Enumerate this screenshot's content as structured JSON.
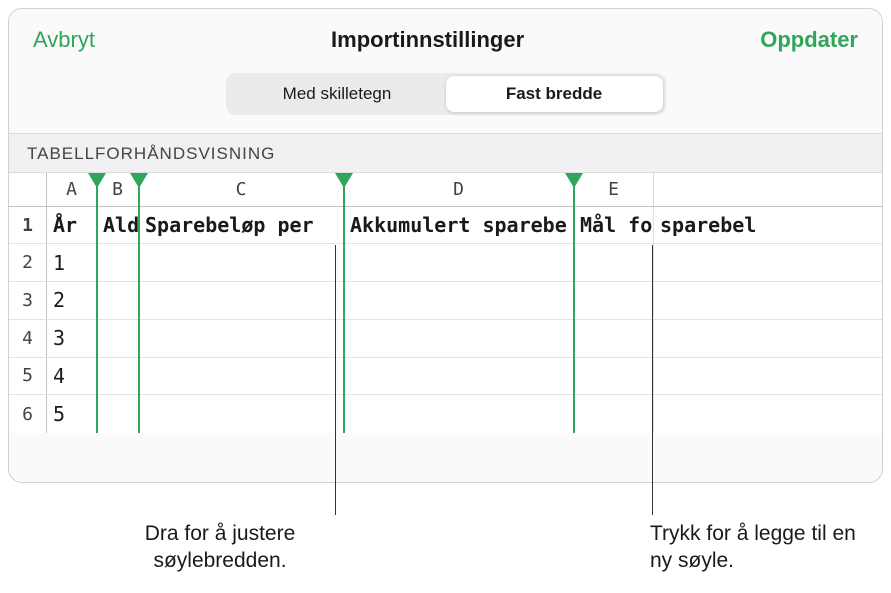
{
  "header": {
    "cancel": "Avbryt",
    "title": "Importinnstillinger",
    "update": "Oppdater"
  },
  "segmented": {
    "delimited": "Med skilletegn",
    "fixed_width": "Fast bredde"
  },
  "section_label": "TABELLFORHÅNDSVISNING",
  "columns": {
    "letters": [
      "A",
      "B",
      "C",
      "D",
      "E"
    ],
    "widths": [
      50,
      42,
      205,
      230,
      80
    ]
  },
  "rows": [
    {
      "num": "1",
      "cells": [
        "År",
        "Ald",
        "Sparebeløp per",
        "Akkumulert sparebe",
        "Mål for"
      ],
      "trailing": "sparebel",
      "bold": true
    },
    {
      "num": "2",
      "cells": [
        "1",
        "",
        "",
        "",
        ""
      ],
      "trailing": "",
      "bold": false
    },
    {
      "num": "3",
      "cells": [
        "2",
        "",
        "",
        "",
        ""
      ],
      "trailing": "",
      "bold": false
    },
    {
      "num": "4",
      "cells": [
        "3",
        "",
        "",
        "",
        ""
      ],
      "trailing": "",
      "bold": false
    },
    {
      "num": "5",
      "cells": [
        "4",
        "",
        "",
        "",
        ""
      ],
      "trailing": "",
      "bold": false
    },
    {
      "num": "6",
      "cells": [
        "5",
        "",
        "",
        "",
        ""
      ],
      "trailing": "",
      "bold": false
    }
  ],
  "callouts": {
    "drag": "Dra for å justere søylebredden.",
    "tap": "Trykk for å legge til en ny søyle."
  }
}
